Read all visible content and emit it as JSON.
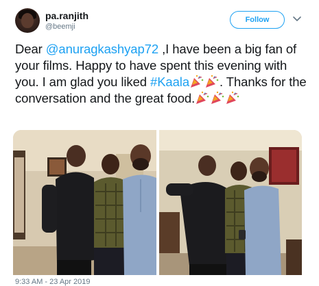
{
  "author": {
    "display_name": "pa.ranjith",
    "handle": "@beemji"
  },
  "follow_label": "Follow",
  "tweet": {
    "part1": "Dear ",
    "mention": "@anuragkashyap72",
    "part2": " ,I have been a big fan of your films. Happy to have spent this evening with you. I am glad you liked ",
    "hashtag": "#Kaala",
    "part3": ". Thanks for the conversation and the great food."
  },
  "timestamp": "9:33 AM - 23 Apr 2019",
  "icons": {
    "caret": "chevron-down-icon",
    "emoji": "party-popper-emoji"
  },
  "colors": {
    "accent": "#1da1f2",
    "text": "#14171a",
    "muted": "#657786"
  }
}
